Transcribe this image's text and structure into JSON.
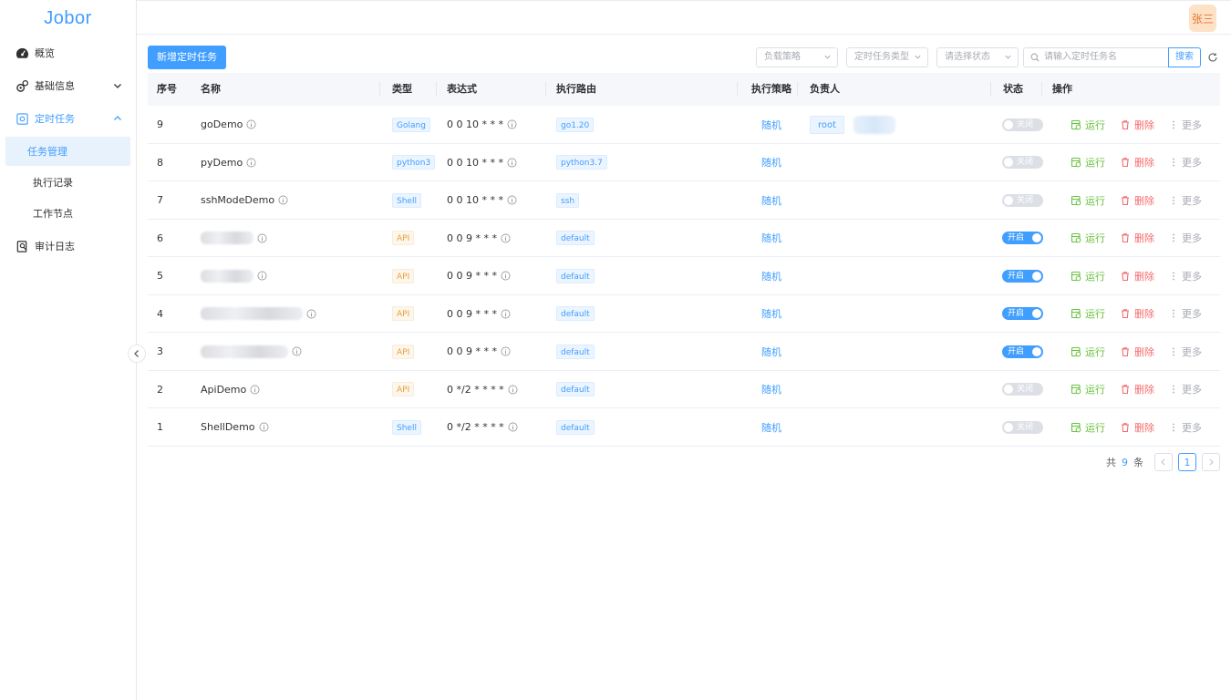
{
  "app": {
    "logo": "Jobor",
    "user_name": "张三"
  },
  "sidebar": {
    "items": [
      {
        "label": "概览"
      },
      {
        "label": "基础信息"
      },
      {
        "label": "定时任务"
      },
      {
        "label": "审计日志"
      }
    ],
    "sub_items": [
      {
        "label": "任务管理"
      },
      {
        "label": "执行记录"
      },
      {
        "label": "工作节点"
      }
    ]
  },
  "toolbar": {
    "new_task_label": "新增定时任务",
    "filter_strategy": "负载策略",
    "filter_type": "定时任务类型",
    "filter_status": "请选择状态",
    "search_placeholder": "请输入定时任务名",
    "search_label": "搜索"
  },
  "table": {
    "headers": [
      "序号",
      "名称",
      "类型",
      "表达式",
      "执行路由",
      "执行策略",
      "负责人",
      "状态",
      "操作"
    ],
    "action_run": "运行",
    "action_delete": "删除",
    "action_more": "更多",
    "rows": [
      {
        "id": "9",
        "name": "goDemo",
        "type": "Golang",
        "expr": "0 0 10 * * *",
        "route": "go1.20",
        "strategy": "随机",
        "owner": "root",
        "status": "关闭"
      },
      {
        "id": "8",
        "name": "pyDemo",
        "type": "python3",
        "expr": "0 0 10 * * *",
        "route": "python3.7",
        "strategy": "随机",
        "owner": "",
        "status": "关闭"
      },
      {
        "id": "7",
        "name": "sshModeDemo",
        "type": "Shell",
        "expr": "0 0 10 * * *",
        "route": "ssh",
        "strategy": "随机",
        "owner": "",
        "status": "关闭"
      },
      {
        "id": "6",
        "name": "",
        "type": "API",
        "expr": "0 0 9 * * *",
        "route": "default",
        "strategy": "随机",
        "owner": "",
        "status": "开启"
      },
      {
        "id": "5",
        "name": "",
        "type": "API",
        "expr": "0 0 9 * * *",
        "route": "default",
        "strategy": "随机",
        "owner": "",
        "status": "开启"
      },
      {
        "id": "4",
        "name": "",
        "type": "API",
        "expr": "0 0 9 * * *",
        "route": "default",
        "strategy": "随机",
        "owner": "",
        "status": "开启"
      },
      {
        "id": "3",
        "name": "",
        "type": "API",
        "expr": "0 0 9 * * *",
        "route": "default",
        "strategy": "随机",
        "owner": "",
        "status": "开启"
      },
      {
        "id": "2",
        "name": "ApiDemo",
        "type": "API",
        "expr": "0 */2 * * * *",
        "route": "default",
        "strategy": "随机",
        "owner": "",
        "status": "关闭"
      },
      {
        "id": "1",
        "name": "ShellDemo",
        "type": "Shell",
        "expr": "0 */2 * * * *",
        "route": "default",
        "strategy": "随机",
        "owner": "",
        "status": "关闭"
      }
    ]
  },
  "pagination": {
    "total_prefix": "共",
    "total": "9",
    "total_suffix": "条",
    "current_page": "1"
  },
  "colors": {
    "primary": "#409eff",
    "success": "#67c23a",
    "danger": "#f56c6c",
    "warning": "#e6a23c"
  }
}
